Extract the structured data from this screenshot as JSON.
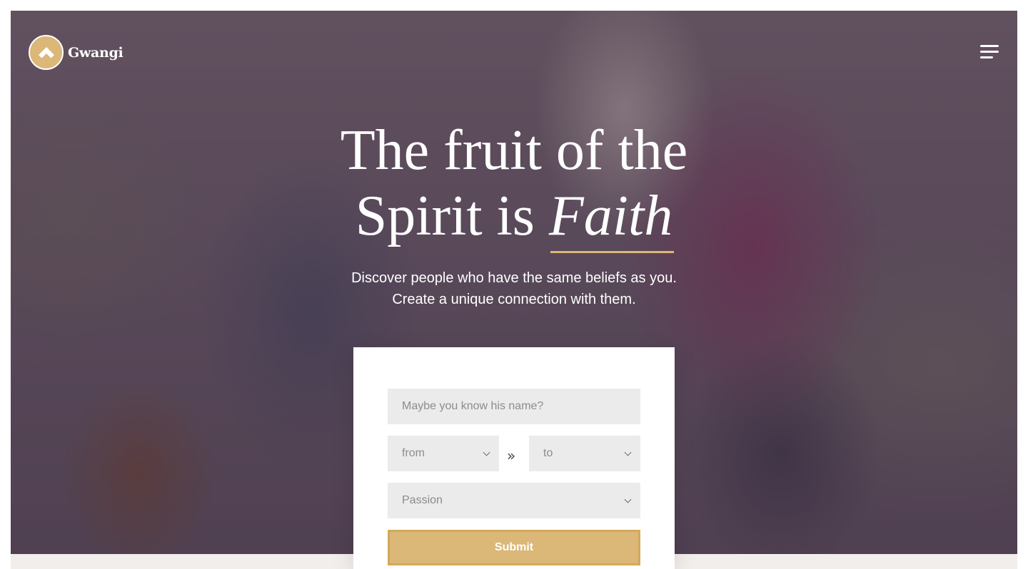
{
  "brand": {
    "name": "Gwangi",
    "logo_icon": "chevron-up-icon",
    "accent_color": "#dbb778"
  },
  "nav": {
    "menu_icon": "hamburger-menu-icon"
  },
  "hero": {
    "headline_line1": "The fruit of the",
    "headline_line2_prefix": "Spirit is",
    "headline_accent": "Faith",
    "subtitle_line1": "Discover people who have the same beliefs as you.",
    "subtitle_line2": "Create a unique connection with them."
  },
  "search_form": {
    "name_placeholder": "Maybe you know his name?",
    "age_from": "from",
    "age_to": "to",
    "range_separator": "»",
    "passion": "Passion",
    "submit_label": "Submit"
  }
}
